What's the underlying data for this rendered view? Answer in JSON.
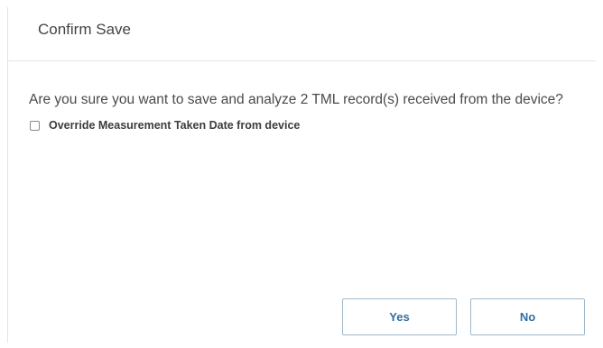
{
  "dialog": {
    "title": "Confirm Save",
    "message": "Are you sure you want to save and analyze 2 TML record(s) received from the device?",
    "checkbox": {
      "label": "Override Measurement Taken Date from device",
      "checked": false
    },
    "buttons": {
      "yes_label": "Yes",
      "no_label": "No"
    }
  },
  "colors": {
    "button_text": "#2f6ea3",
    "button_border": "#9fb8cc",
    "divider": "#e6e6e6"
  }
}
